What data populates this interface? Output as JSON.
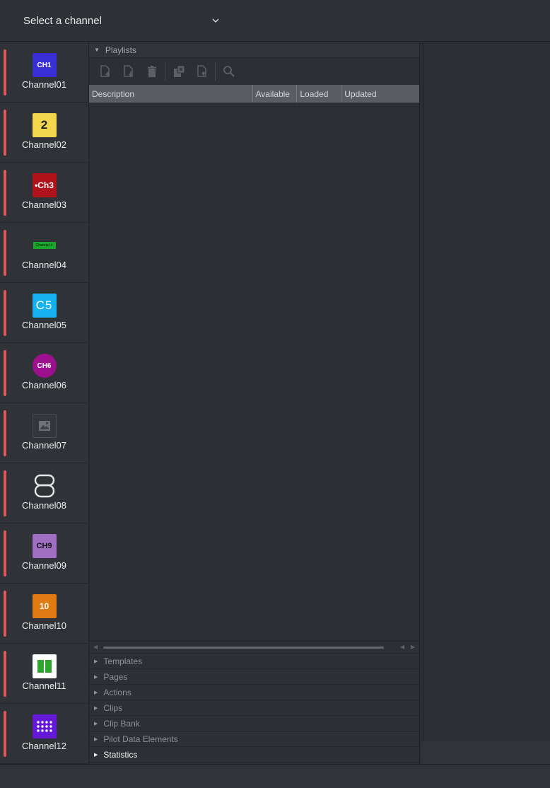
{
  "header": {
    "channel_select_label": "Select a channel"
  },
  "channels": [
    {
      "name": "Channel01",
      "logo_text": "CH1",
      "logo_bg": "#3a2fd6",
      "logo_fg": "#ffffff"
    },
    {
      "name": "Channel02",
      "logo_text": "2",
      "logo_bg": "#f2d64b",
      "logo_fg": "#222222"
    },
    {
      "name": "Channel03",
      "logo_text": "•Ch3",
      "logo_bg": "#b0121b",
      "logo_fg": "#ffffff"
    },
    {
      "name": "Channel04",
      "logo_text": "Channel 4",
      "logo_bg": "#19a82a",
      "logo_fg": "#083d0e"
    },
    {
      "name": "Channel05",
      "logo_text": "C5",
      "logo_bg": "#15b2ef",
      "logo_fg": "#ffffff"
    },
    {
      "name": "Channel06",
      "logo_text": "CH6",
      "logo_bg": "#9c0f8d",
      "logo_fg": "#ffffff"
    },
    {
      "name": "Channel07",
      "logo_text": "",
      "logo_bg": "#33363a",
      "logo_fg": "#7e8287"
    },
    {
      "name": "Channel08",
      "logo_text": "8",
      "logo_bg": "transparent",
      "logo_fg": "#e6e6e6"
    },
    {
      "name": "Channel09",
      "logo_text": "CH9",
      "logo_bg": "#a06fc4",
      "logo_fg": "#111111"
    },
    {
      "name": "Channel10",
      "logo_text": "10",
      "logo_bg": "#e07a12",
      "logo_fg": "#ffffff"
    },
    {
      "name": "Channel11",
      "logo_text": "",
      "logo_bg": "#ffffff",
      "logo_fg": "#2ea52e"
    },
    {
      "name": "Channel12",
      "logo_text": "",
      "logo_bg": "#6418d8",
      "logo_fg": "#ffffff"
    }
  ],
  "playlists": {
    "section_title": "Playlists",
    "toolbar": [
      {
        "name": "new-playlist-icon"
      },
      {
        "name": "import-playlist-icon"
      },
      {
        "name": "delete-playlist-icon"
      },
      {
        "name": "copy-playlist-icon"
      },
      {
        "name": "export-playlist-icon"
      },
      {
        "name": "search-icon"
      }
    ],
    "columns": [
      "Description",
      "Available",
      "Loaded",
      "Updated"
    ],
    "rows": []
  },
  "sections": [
    {
      "label": "Templates",
      "active": false
    },
    {
      "label": "Pages",
      "active": false
    },
    {
      "label": "Actions",
      "active": false
    },
    {
      "label": "Clips",
      "active": false
    },
    {
      "label": "Clip Bank",
      "active": false
    },
    {
      "label": "Pilot Data Elements",
      "active": false
    },
    {
      "label": "Statistics",
      "active": true
    }
  ],
  "colors": {
    "channel_indicator": "#e0585c",
    "header_bg": "#5a5e63"
  }
}
